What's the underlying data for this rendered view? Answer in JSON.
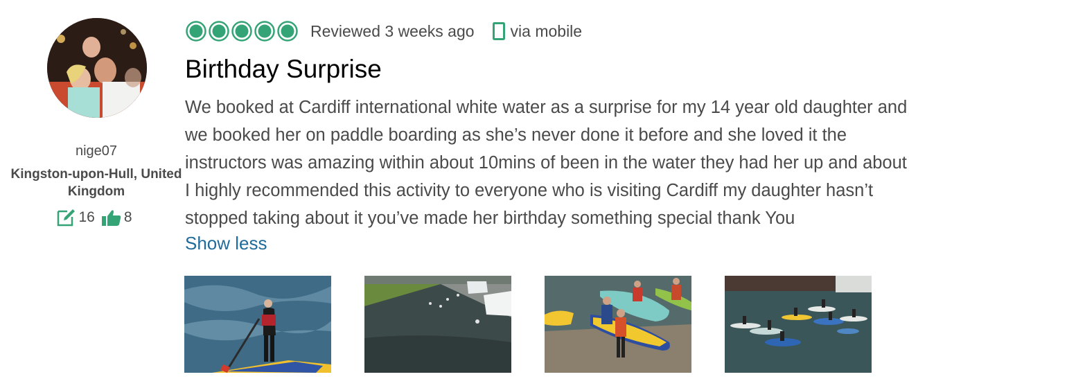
{
  "reviewer": {
    "username": "nige07",
    "location": "Kingston-upon-Hull, United Kingdom",
    "contributions": "16",
    "helpful_votes": "8",
    "icons": {
      "contributions": "edit-note-icon",
      "helpful": "thumbs-up-icon"
    }
  },
  "review": {
    "rating": 5,
    "rating_max": 5,
    "reviewed": "Reviewed 3 weeks ago",
    "device": "via mobile",
    "device_icon": "mobile-phone-icon",
    "title": "Birthday Surprise",
    "body_lines": [
      "We booked at Cardiff international white water as a surprise for my 14 year old daughter and",
      "we booked her on paddle boarding as she’s never done it before and she loved it the",
      "instructors was amazing within about 10mins of been in the water they had her up and about",
      "I highly recommended this activity to everyone who is visiting Cardiff my daughter hasn’t",
      "stopped taking about it you’ve made her birthday something special thank You"
    ],
    "show_less": "Show less"
  },
  "colors": {
    "bubble_green": "#34a476",
    "link": "#1f6c9c",
    "text": "#4a4a4a",
    "title": "#000000"
  }
}
